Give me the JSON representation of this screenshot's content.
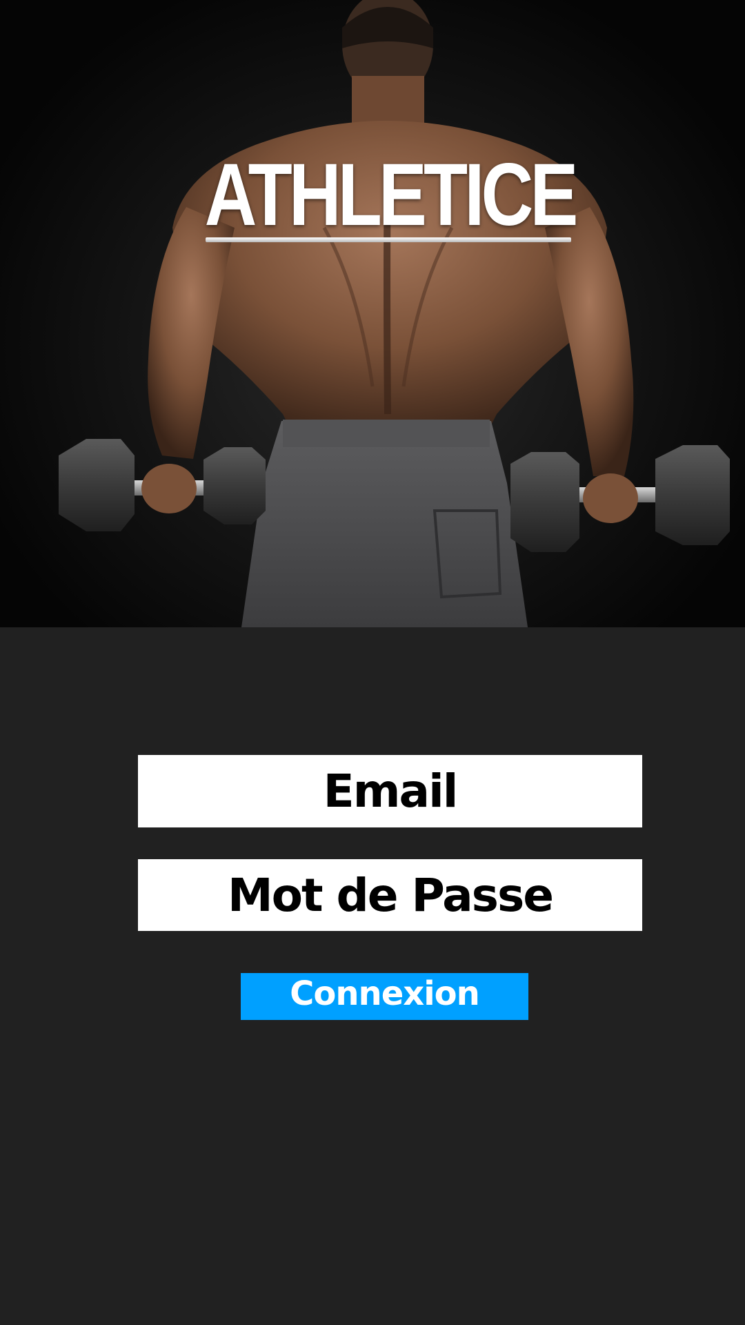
{
  "app": {
    "title": "ATHLETICE"
  },
  "hero": {
    "image": "athlete-back-dumbbells"
  },
  "login_form": {
    "email_placeholder": "Email",
    "password_placeholder": "Mot de Passe",
    "submit_label": "Connexion"
  },
  "colors": {
    "background": "#212121",
    "accent": "#00a0ff",
    "field_background": "#ffffff"
  }
}
